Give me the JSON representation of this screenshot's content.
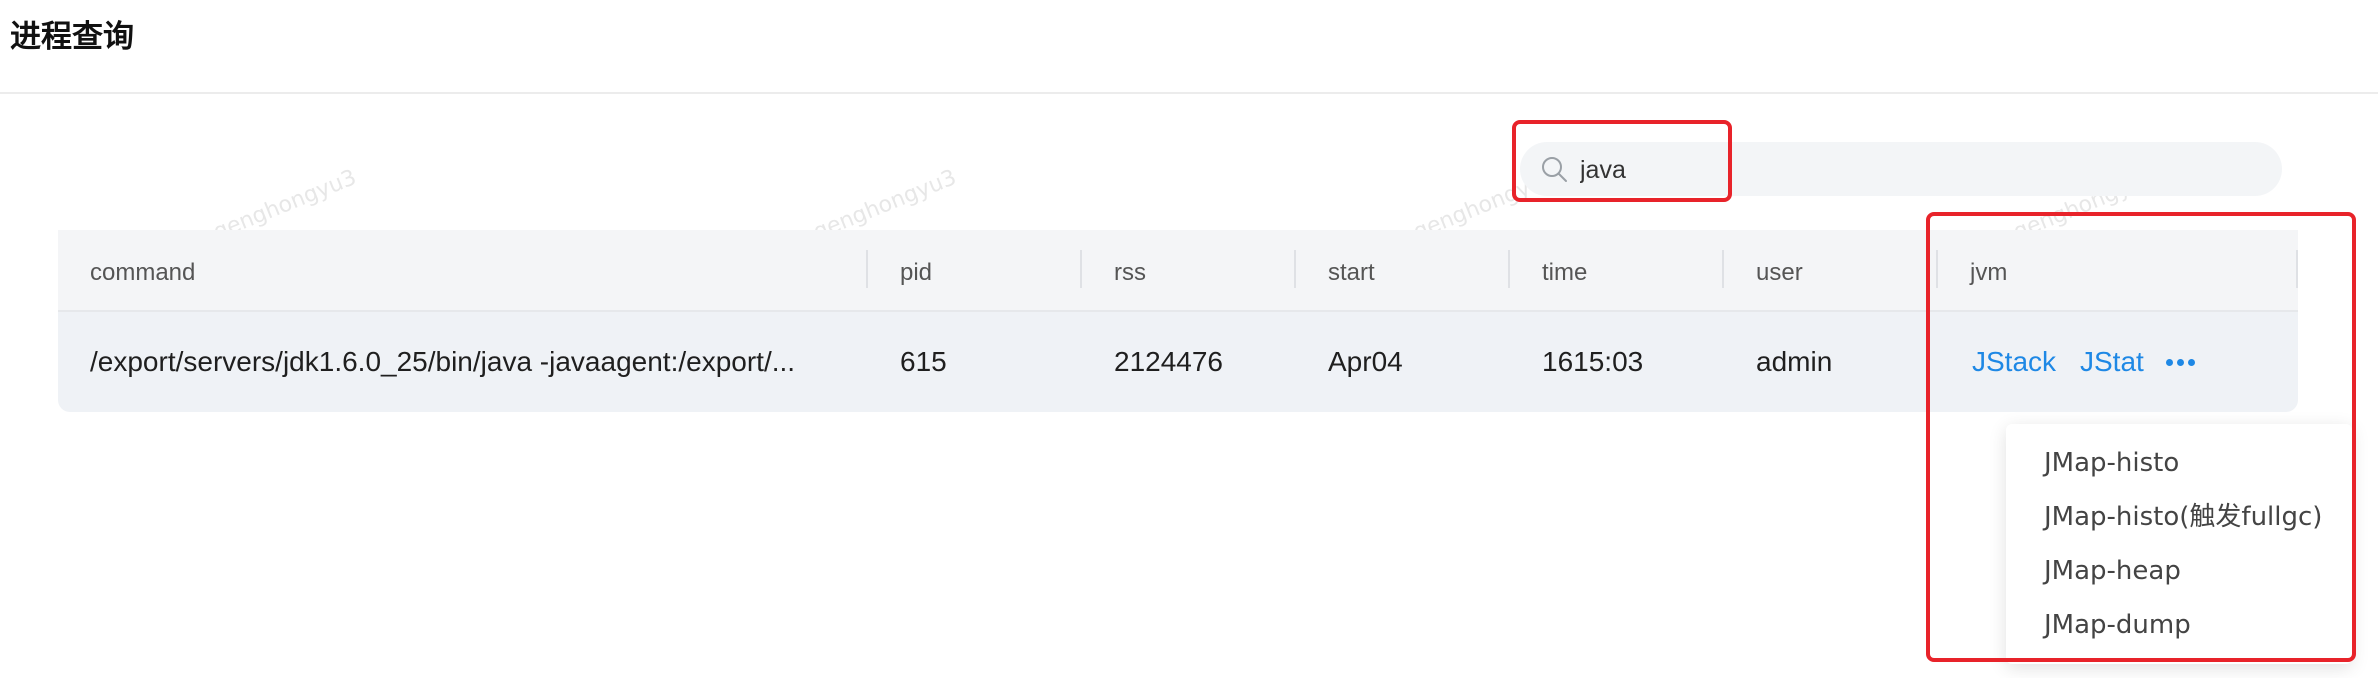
{
  "page": {
    "title": "进程查询"
  },
  "watermark": "genghongyu3",
  "search": {
    "value": "java",
    "icon": "search-icon"
  },
  "table": {
    "columns": [
      "command",
      "pid",
      "rss",
      "start",
      "time",
      "user",
      "jvm"
    ],
    "rows": [
      {
        "command": "/export/servers/jdk1.6.0_25/bin/java -javaagent:/export/...",
        "pid": "615",
        "rss": "2124476",
        "start": "Apr04",
        "time": "1615:03",
        "user": "admin",
        "actions": {
          "jstack": "JStack",
          "jstat": "JStat",
          "more_icon": "more-horizontal-icon"
        }
      }
    ]
  },
  "dropdown": {
    "items": [
      "JMap-histo",
      "JMap-histo(触发fullgc)",
      "JMap-heap",
      "JMap-dump"
    ]
  },
  "colors": {
    "link": "#1e88e5",
    "highlight": "#e8232a",
    "header_bg": "#f4f5f7",
    "row_bg": "#eff2f6"
  }
}
